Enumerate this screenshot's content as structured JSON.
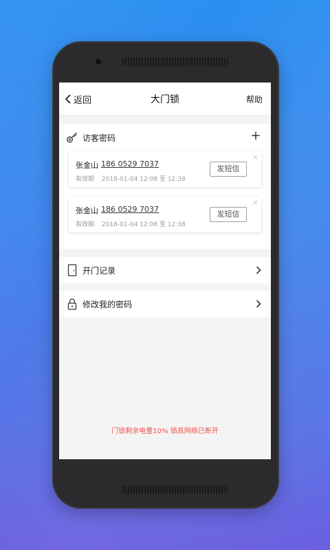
{
  "navbar": {
    "back_label": "返回",
    "title": "大门锁",
    "help_label": "帮助"
  },
  "visitor": {
    "title": "访客密码",
    "add_label": "+",
    "cards": [
      {
        "name": "张金山",
        "phone": "186 0529 7037",
        "valid_label": "有效期",
        "valid_range": "2018-01-04 12:08 至 12:38",
        "sms_label": "发短信",
        "close_label": "×"
      },
      {
        "name": "张金山",
        "phone": "186 0529 7037",
        "valid_label": "有效期",
        "valid_range": "2018-01-04 12:08 至 12:38",
        "sms_label": "发短信",
        "close_label": "×"
      }
    ]
  },
  "menu": {
    "open_records": "开门记录",
    "change_password": "修改我的密码"
  },
  "status": {
    "message": "门锁剩余电量10%  锁具网络已断开",
    "color": "#ef5350"
  }
}
